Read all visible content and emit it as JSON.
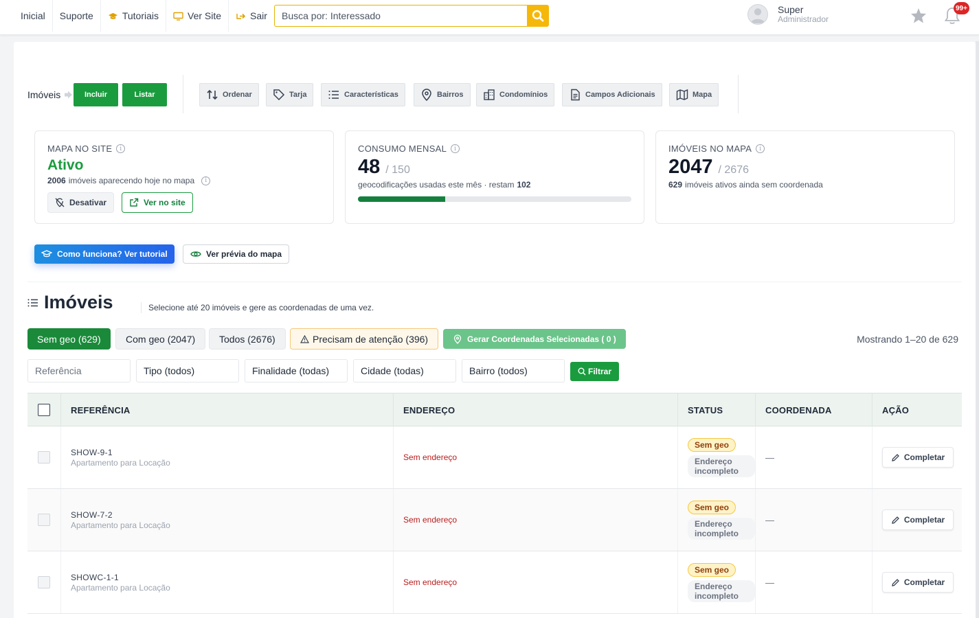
{
  "topnav": {
    "items": [
      {
        "label": "Inicial",
        "icon": ""
      },
      {
        "label": "Suporte",
        "icon": ""
      },
      {
        "label": "Tutoriais",
        "icon": "graduation-cap-icon"
      },
      {
        "label": "Ver Site",
        "icon": "monitor-icon"
      },
      {
        "label": "Sair",
        "icon": "logout-icon"
      }
    ],
    "search_placeholder": "Busca por: Interessado",
    "user_name": "Super",
    "user_role": "Administrador",
    "notif_count": "99+"
  },
  "toolbar": {
    "crumb": "Imóveis",
    "incluir": "Incluir",
    "listar": "Listar",
    "tools": [
      "Ordenar",
      "Tarja",
      "Características",
      "Bairros",
      "Condomínios",
      "Campos Adicionais",
      "Mapa"
    ]
  },
  "cards": {
    "mapa": {
      "title": "MAPA NO SITE",
      "status": "Ativo",
      "count": "2006",
      "sub": "imóveis aparecendo hoje no mapa",
      "btn_desativar": "Desativar",
      "btn_ver": "Ver no site"
    },
    "consumo": {
      "title": "CONSUMO MENSAL",
      "used": "48",
      "total": "/ 150",
      "sub": "geocodificações usadas este mês · restam",
      "remaining": "102",
      "progress_fraction": 0.32
    },
    "imoveis_mapa": {
      "title": "IMÓVEIS NO MAPA",
      "count": "2047",
      "total": "/ 2676",
      "missing": "629",
      "sub": "imóveis ativos ainda sem coordenada"
    }
  },
  "actions": {
    "tutorial": "Como funciona? Ver tutorial",
    "preview": "Ver prévia do mapa"
  },
  "section": {
    "title": "Imóveis",
    "desc": "Selecione até 20 imóveis e gere as coordenadas de uma vez."
  },
  "tabs": {
    "sem_geo": "Sem geo (629)",
    "com_geo": "Com geo (2047)",
    "todos": "Todos (2676)",
    "atencao": "Precisam de atenção (396)",
    "gerar": "Gerar Coordenadas Selecionadas ( 0 )",
    "showing": "Mostrando 1–20 de 629"
  },
  "filters": {
    "referencia": "Referência",
    "tipo": "Tipo (todos)",
    "finalidade": "Finalidade (todas)",
    "cidade": "Cidade (todas)",
    "bairro": "Bairro (todos)",
    "btn": "Filtrar"
  },
  "table": {
    "headers": [
      "REFERÊNCIA",
      "ENDEREÇO",
      "STATUS",
      "COORDENADA",
      "AÇÃO"
    ],
    "rows": [
      {
        "ref": "SHOW-9-1",
        "type": "Apartamento para Locação",
        "addr": "Sem endereço",
        "status1": "Sem geo",
        "status2": "Endereço incompleto",
        "coord": "—",
        "action": "Completar"
      },
      {
        "ref": "SHOW-7-2",
        "type": "Apartamento para Locação",
        "addr": "Sem endereço",
        "status1": "Sem geo",
        "status2": "Endereço incompleto",
        "coord": "—",
        "action": "Completar"
      },
      {
        "ref": "SHOWC-1-1",
        "type": "Apartamento para Locação",
        "addr": "Sem endereço",
        "status1": "Sem geo",
        "status2": "Endereço incompleto",
        "coord": "—",
        "action": "Completar"
      }
    ]
  },
  "colors": {
    "green": "#1a9c3e",
    "accent_yellow": "#f5b80a",
    "blue": "#1d6fe0"
  }
}
